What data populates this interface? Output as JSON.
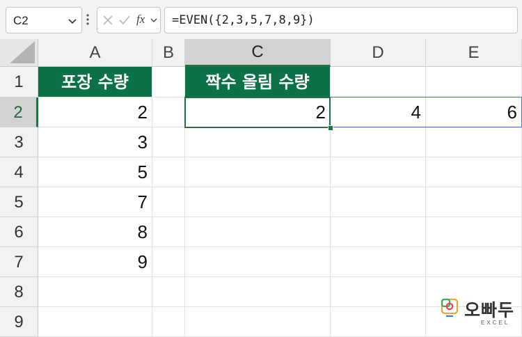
{
  "formula_bar": {
    "name_box": "C2",
    "fx_label": "fx",
    "formula": "=EVEN({2,3,5,7,8,9})"
  },
  "columns": [
    "A",
    "B",
    "C",
    "D",
    "E"
  ],
  "selected_column": "C",
  "rows": [
    "1",
    "2",
    "3",
    "4",
    "5",
    "6",
    "7",
    "8",
    "9"
  ],
  "selected_row": "2",
  "headers": {
    "a1": "포장 수량",
    "c1": "짝수 올림 수량"
  },
  "column_a_values": [
    "2",
    "3",
    "5",
    "7",
    "8",
    "9"
  ],
  "spill_results": [
    "2",
    "4",
    "6"
  ],
  "watermark": {
    "brand": "오빠두",
    "sub": "EXCEL"
  },
  "colors": {
    "header_fill": "#0b7248",
    "selection": "#217346",
    "spill_border": "#3a73c8"
  }
}
